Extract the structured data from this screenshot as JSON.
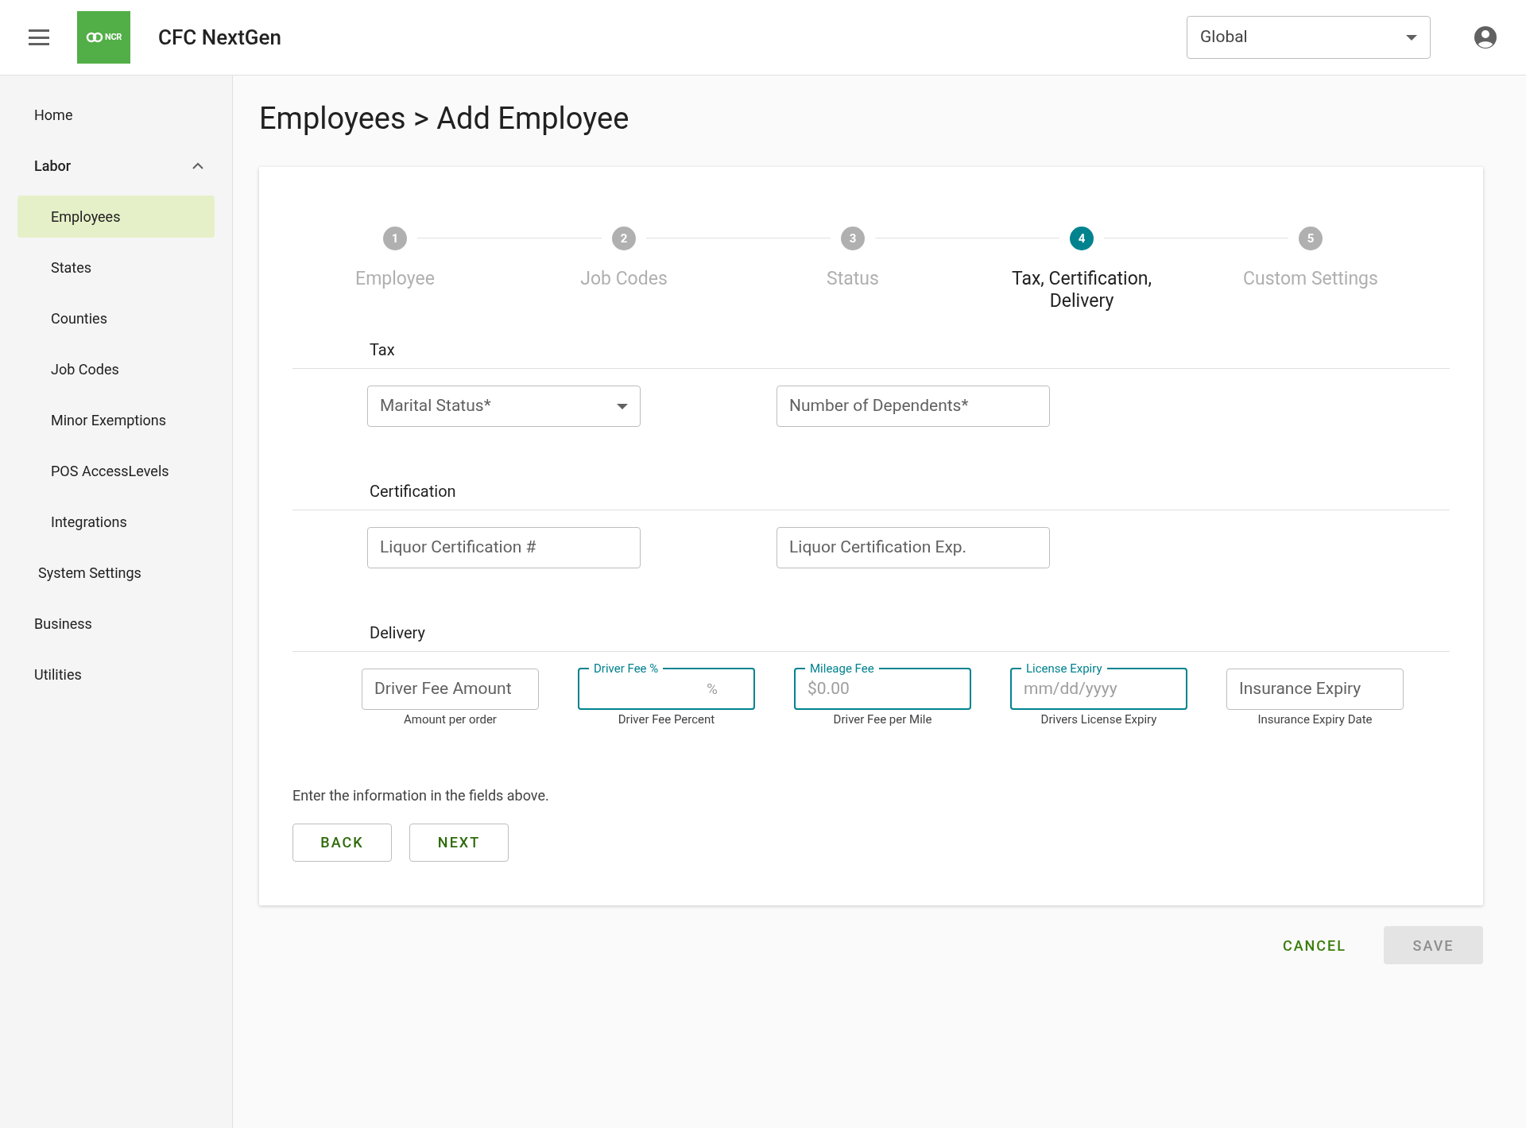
{
  "header": {
    "logo_text": "NCR",
    "app_title": "CFC NextGen",
    "scope_select": {
      "value": "Global"
    }
  },
  "sidebar": {
    "items": [
      {
        "label": "Home",
        "selected": false
      },
      {
        "label": "Labor",
        "selected": false,
        "expanded": true,
        "children": [
          {
            "label": "Employees",
            "selected": true
          },
          {
            "label": "States",
            "selected": false
          },
          {
            "label": "Counties",
            "selected": false
          },
          {
            "label": "Job Codes",
            "selected": false
          },
          {
            "label": "Minor Exemptions",
            "selected": false
          },
          {
            "label": "POS AccessLevels",
            "selected": false
          },
          {
            "label": "Integrations",
            "selected": false
          }
        ]
      },
      {
        "label": "System Settings",
        "selected": false,
        "kind": "indented"
      },
      {
        "label": "Business",
        "selected": false
      },
      {
        "label": "Utilities",
        "selected": false
      }
    ]
  },
  "page_title": "Employees > Add Employee",
  "stepper": [
    {
      "number": "1",
      "label": "Employee",
      "selected": false
    },
    {
      "number": "2",
      "label": "Job Codes",
      "selected": false
    },
    {
      "number": "3",
      "label": "Status",
      "selected": false
    },
    {
      "number": "4",
      "label": "Tax, Certification, Delivery",
      "selected": true
    },
    {
      "number": "5",
      "label": "Custom Settings",
      "selected": false
    }
  ],
  "sections": [
    {
      "title": "Tax",
      "fields": [
        {
          "kind": "select",
          "placeholder": "Marital Status*"
        },
        {
          "kind": "text",
          "placeholder": "Number of Dependents*"
        }
      ]
    },
    {
      "title": "Certification",
      "fields": [
        {
          "kind": "text",
          "placeholder": "Liquor Certification #"
        },
        {
          "kind": "text",
          "placeholder": "Liquor Certification Exp."
        }
      ]
    },
    {
      "title": "Delivery",
      "kind": "compact",
      "fields": [
        {
          "kind": "text",
          "placeholder": "Driver Fee Amount",
          "helper": "Amount per order"
        },
        {
          "kind": "text",
          "label": "Driver Fee %",
          "suffix": "%",
          "helper": "Driver Fee Percent",
          "focused": true
        },
        {
          "kind": "text",
          "label": "Mileage Fee",
          "placeholder": "$0.00",
          "helper": "Driver Fee per Mile",
          "focused": true
        },
        {
          "kind": "text",
          "label": "License Expiry",
          "placeholder": "mm/dd/yyyy",
          "helper": "Drivers License Expiry",
          "focused": true
        },
        {
          "kind": "text",
          "placeholder": "Insurance Expiry",
          "helper": "Insurance Expiry Date"
        }
      ]
    }
  ],
  "instructions": "Enter the information in the fields above.",
  "step_buttons": [
    "BACK",
    "NEXT"
  ],
  "footer_buttons": [
    {
      "label": "CANCEL",
      "disabled": false
    },
    {
      "label": "SAVE",
      "disabled": true
    }
  ]
}
